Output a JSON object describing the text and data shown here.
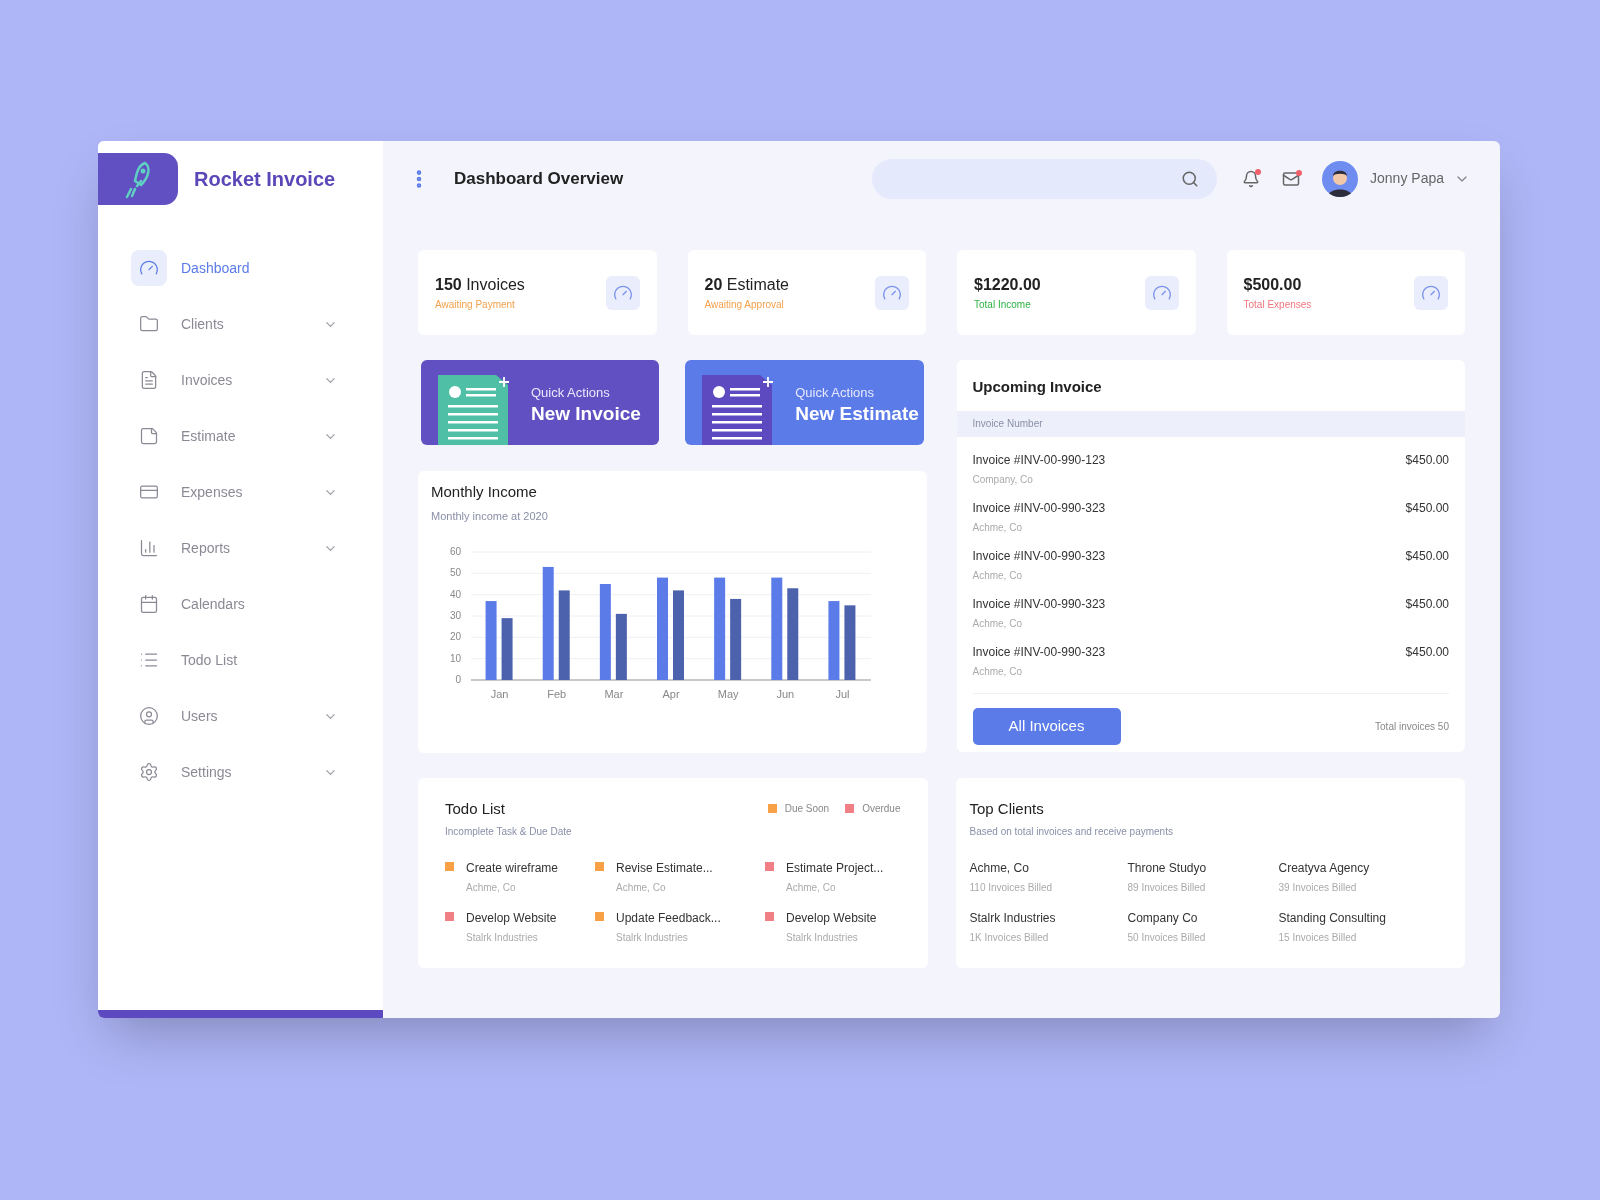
{
  "brand": {
    "name": "Rocket Invoice"
  },
  "sidebar": {
    "items": [
      {
        "label": "Dashboard",
        "selected": true,
        "has_submenu": false
      },
      {
        "label": "Clients",
        "selected": false,
        "has_submenu": true
      },
      {
        "label": "Invoices",
        "selected": false,
        "has_submenu": true
      },
      {
        "label": "Estimate",
        "selected": false,
        "has_submenu": true
      },
      {
        "label": "Expenses",
        "selected": false,
        "has_submenu": true
      },
      {
        "label": "Reports",
        "selected": false,
        "has_submenu": true
      },
      {
        "label": "Calendars",
        "selected": false,
        "has_submenu": false
      },
      {
        "label": "Todo List",
        "selected": false,
        "has_submenu": false
      },
      {
        "label": "Users",
        "selected": false,
        "has_submenu": true
      },
      {
        "label": "Settings",
        "selected": false,
        "has_submenu": true
      }
    ]
  },
  "header": {
    "title": "Dashboard Overview",
    "notifications_unread": true,
    "messages_unread": true,
    "user": "Jonny Papa"
  },
  "stats": [
    {
      "value": "150",
      "unit": "Invoices",
      "caption": "Awaiting Payment",
      "kind": "pending"
    },
    {
      "value": "20",
      "unit": "Estimate",
      "caption": "Awaiting Approval",
      "kind": "pending"
    },
    {
      "value": "$1220.00",
      "caption": "Total Income",
      "kind": "income"
    },
    {
      "value": "$500.00",
      "caption": "Total Expenses",
      "kind": "expense"
    }
  ],
  "quick_actions": [
    {
      "label": "Quick Actions",
      "title": "New Invoice",
      "color": "#6150c1"
    },
    {
      "label": "Quick Actions",
      "title": "New Estimate",
      "color": "#5b7be8"
    }
  ],
  "monthly_income": {
    "title": "Monthly Income",
    "subtitle": "Monthly income at 2020",
    "chart_data": {
      "type": "bar",
      "categories": [
        "Jan",
        "Feb",
        "Mar",
        "Apr",
        "May",
        "Jun",
        "Jul"
      ],
      "series": [
        {
          "color": "#5b7be8",
          "values": [
            37,
            53,
            45,
            48,
            48,
            48,
            37
          ]
        },
        {
          "color": "#4c62ad",
          "values": [
            29,
            42,
            31,
            42,
            38,
            43,
            35
          ]
        }
      ],
      "ylim": [
        0,
        60
      ],
      "yticks": [
        0,
        10,
        20,
        30,
        40,
        50,
        60
      ],
      "grid": true
    }
  },
  "upcoming_invoice": {
    "title": "Upcoming Invoice",
    "column": "Invoice Number",
    "rows": [
      {
        "number": "Invoice #INV-00-990-123",
        "client": "Company, Co",
        "amount": "$450.00"
      },
      {
        "number": "Invoice #INV-00-990-323",
        "client": "Achme, Co",
        "amount": "$450.00"
      },
      {
        "number": "Invoice #INV-00-990-323",
        "client": "Achme, Co",
        "amount": "$450.00"
      },
      {
        "number": "Invoice #INV-00-990-323",
        "client": "Achme, Co",
        "amount": "$450.00"
      },
      {
        "number": "Invoice #INV-00-990-323",
        "client": "Achme, Co",
        "amount": "$450.00"
      }
    ],
    "button": "All Invoices",
    "total": "Total invoices 50"
  },
  "todo": {
    "title": "Todo List",
    "subtitle": "Incomplete Task & Due Date",
    "legend": [
      {
        "label": "Due Soon",
        "color": "#f7a046"
      },
      {
        "label": "Overdue",
        "color": "#f07f86"
      }
    ],
    "items": [
      {
        "task": "Create wireframe",
        "client": "Achme, Co",
        "color": "#f7a046"
      },
      {
        "task": "Revise Estimate...",
        "client": "Achme, Co",
        "color": "#f7a046"
      },
      {
        "task": "Estimate Project...",
        "client": "Achme, Co",
        "color": "#f07f86"
      },
      {
        "task": "Develop Website",
        "client": "Stalrk Industries",
        "color": "#f07f86"
      },
      {
        "task": "Update Feedback...",
        "client": "Stalrk Industries",
        "color": "#f7a046"
      },
      {
        "task": "Develop Website",
        "client": "Stalrk Industries",
        "color": "#f07f86"
      }
    ]
  },
  "top_clients": {
    "title": "Top Clients",
    "subtitle": "Based on total invoices and receive payments",
    "clients": [
      {
        "name": "Achme, Co",
        "billed": "110 Invoices Billed"
      },
      {
        "name": "Throne Studyo",
        "billed": "89 Invoices Billed"
      },
      {
        "name": "Creatyva Agency",
        "billed": "39 Invoices Billed"
      },
      {
        "name": "Stalrk Industries",
        "billed": "1K Invoices Billed"
      },
      {
        "name": "Company Co",
        "billed": "50 Invoices Billed"
      },
      {
        "name": "Standing Consulting",
        "billed": "15 Invoices Billed"
      }
    ]
  }
}
